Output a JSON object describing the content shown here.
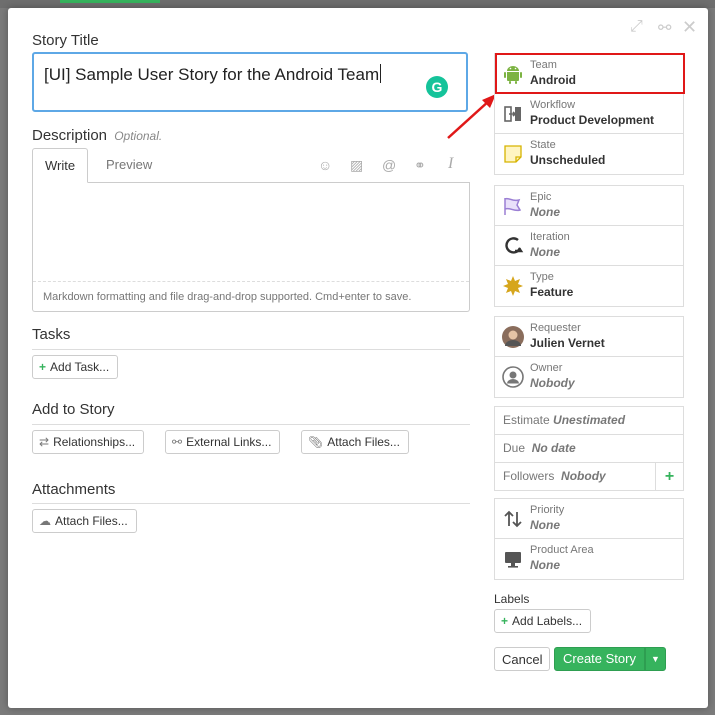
{
  "form": {
    "title_label": "Story Title",
    "title_value": "[UI] Sample User Story for the Android Team",
    "grammarly_icon_glyph": "G",
    "description_label": "Description",
    "description_optional": "Optional.",
    "tab_write": "Write",
    "tab_preview": "Preview",
    "editor_hint": "Markdown formatting and file drag-and-drop supported. Cmd+enter to save.",
    "tasks_label": "Tasks",
    "add_task": "Add Task...",
    "add_to_story_label": "Add to Story",
    "relationships": "Relationships...",
    "external_links": "External Links...",
    "attach_files": "Attach Files...",
    "attachments_label": "Attachments",
    "attach_files_2": "Attach Files..."
  },
  "sidebar": {
    "team_label": "Team",
    "team_value": "Android",
    "workflow_label": "Workflow",
    "workflow_value": "Product Development",
    "state_label": "State",
    "state_value": "Unscheduled",
    "epic_label": "Epic",
    "epic_value": "None",
    "iteration_label": "Iteration",
    "iteration_value": "None",
    "type_label": "Type",
    "type_value": "Feature",
    "requester_label": "Requester",
    "requester_value": "Julien Vernet",
    "owner_label": "Owner",
    "owner_value": "Nobody",
    "estimate_label": "Estimate",
    "estimate_value": "Unestimated",
    "due_label": "Due",
    "due_value": "No date",
    "followers_label": "Followers",
    "followers_value": "Nobody",
    "priority_label": "Priority",
    "priority_value": "None",
    "product_area_label": "Product Area",
    "product_area_value": "None",
    "labels_label": "Labels",
    "add_labels": "Add Labels...",
    "cancel": "Cancel",
    "create_story": "Create Story"
  },
  "colors": {
    "accent": "#36b35d",
    "highlight": "#e01818",
    "focus": "#5ea8e6",
    "android": "#7cb342",
    "feature": "#d6a61d",
    "epic": "#9b7fd4"
  }
}
